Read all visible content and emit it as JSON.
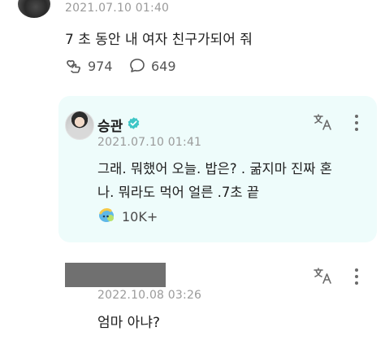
{
  "top_comment": {
    "timestamp": "2021.07.10 01:40",
    "text": "7 초 동안 내 여자 친구가되어 줘",
    "likes": "974",
    "replies": "649"
  },
  "reply": {
    "author": "승관",
    "timestamp": "2021.07.10 01:41",
    "line1": "그래. 뭐했어 오늘. 밥은? . 굶지마 진짜 혼",
    "line2": "나. 뭐라도 먹어 얼른 .7초 끝",
    "likes": "10K+"
  },
  "bottom_comment": {
    "timestamp": "2022.10.08 03:26",
    "text": "엄마 아냐?"
  },
  "colors": {
    "card_bg": "#eefcfb",
    "verified": "#3ec6c6",
    "muted": "#9a9a9a"
  },
  "icons": {
    "like": "heart-hand-icon",
    "reply": "speech-bubble-icon",
    "translate": "translate-icon",
    "more": "more-vertical-icon",
    "verified": "verified-badge-icon",
    "artist_like": "artist-like-icon"
  }
}
